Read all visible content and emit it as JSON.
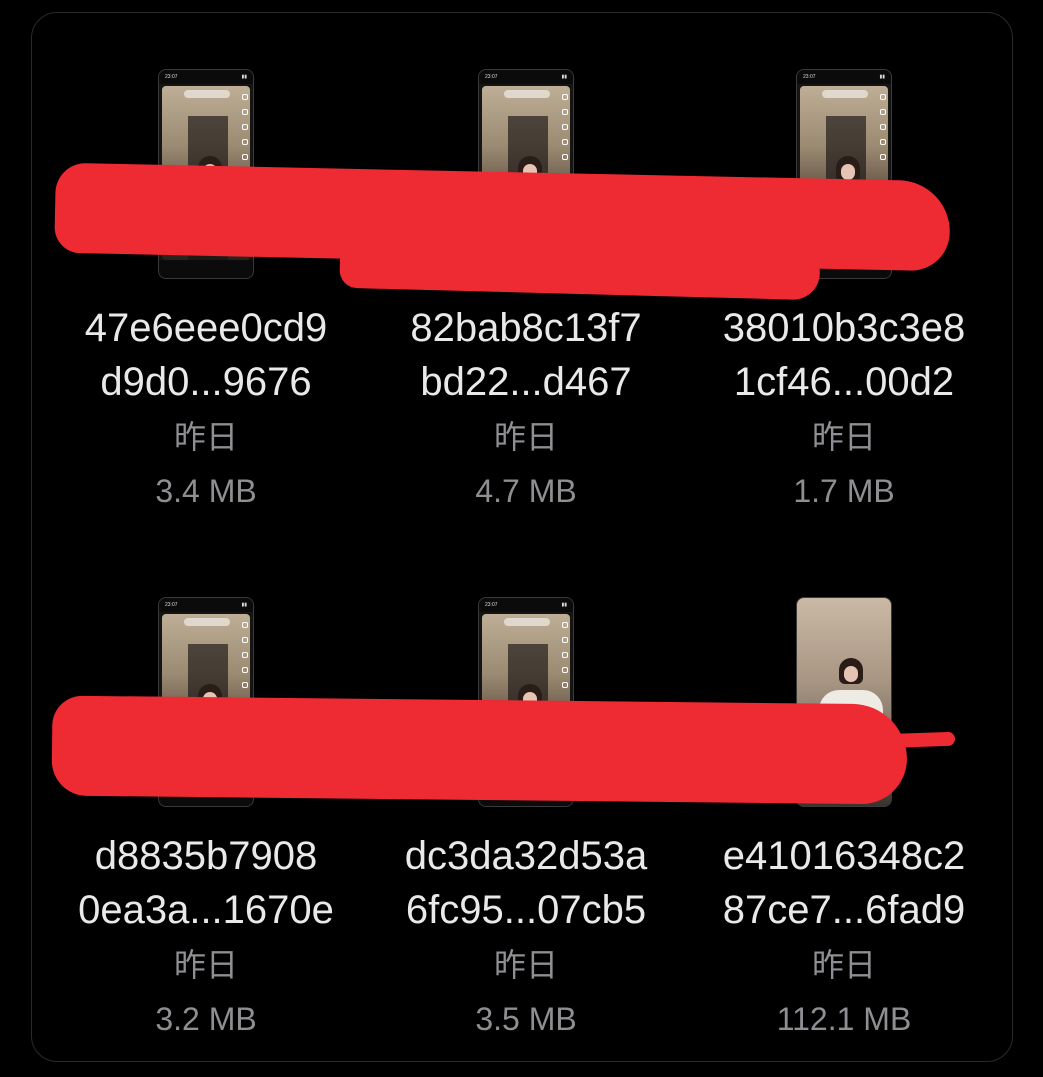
{
  "files": [
    {
      "name_line1": "47e6eee0cd9",
      "name_line2": "d9d0...9676",
      "date": "昨日",
      "size": "3.4 MB"
    },
    {
      "name_line1": "82bab8c13f7",
      "name_line2": "bd22...d467",
      "date": "昨日",
      "size": "4.7 MB"
    },
    {
      "name_line1": "38010b3c3e8",
      "name_line2": "1cf46...00d2",
      "date": "昨日",
      "size": "1.7 MB"
    },
    {
      "name_line1": "d8835b7908",
      "name_line2": "0ea3a...1670e",
      "date": "昨日",
      "size": "3.2 MB"
    },
    {
      "name_line1": "dc3da32d53a",
      "name_line2": "6fc95...07cb5",
      "date": "昨日",
      "size": "3.5 MB"
    },
    {
      "name_line1": "e41016348c2",
      "name_line2": "87ce7...6fad9",
      "date": "昨日",
      "size": "112.1 MB"
    }
  ],
  "colors": {
    "background": "#000000",
    "filename": "#e9e9e9",
    "meta": "#8e8e93",
    "redaction": "#ee2a33"
  }
}
